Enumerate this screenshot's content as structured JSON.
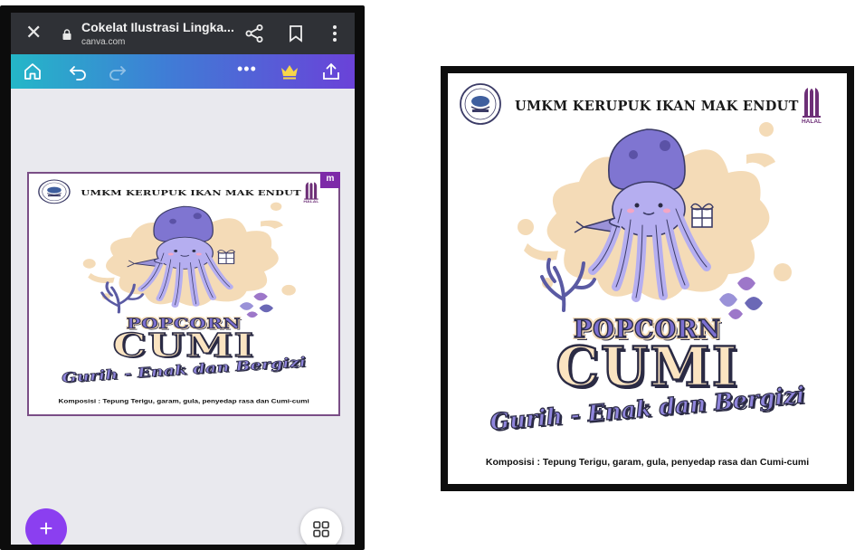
{
  "browser": {
    "title": "Cokelat Ilustrasi Lingka...",
    "url": "canva.com"
  },
  "canva_toolbar": {
    "more_label": "•••"
  },
  "badge": {
    "letter": "m"
  },
  "fab": {
    "add_label": "+"
  },
  "design": {
    "brand": "UMKM KERUPUK IKAN MAK ENDUT",
    "halal_label": "HALAL",
    "title_line1": "POPCORN",
    "title_line2": "CUMI",
    "tagline": "Gurih - Enak dan Bergizi",
    "composition": "Komposisi : Tepung Terigu, garam, gula, penyedap rasa dan Cumi-cumi"
  },
  "colors": {
    "squid": "#9f97e6",
    "splash": "#f4dbb7",
    "accent": "#7d2aa8",
    "fab": "#8b3ff0"
  }
}
